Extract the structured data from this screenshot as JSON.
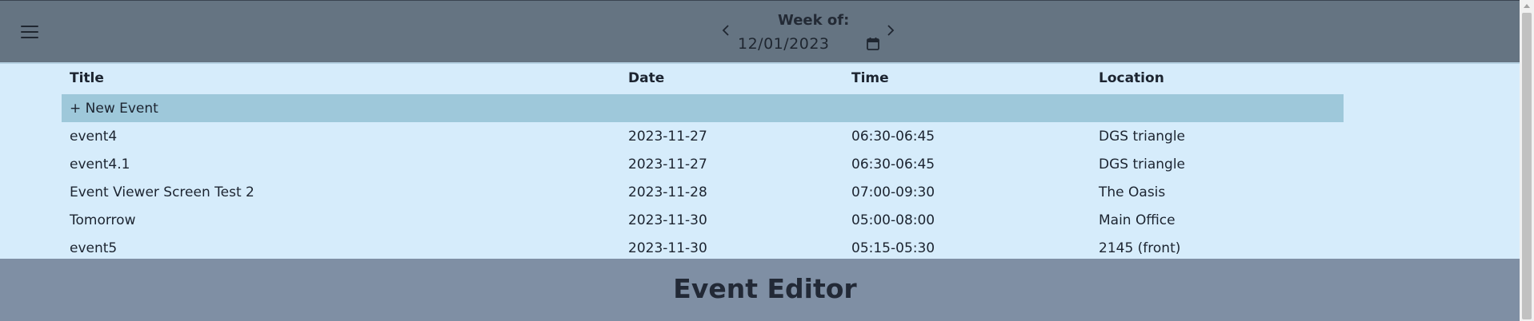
{
  "header": {
    "menu_icon": "hamburger-menu-icon",
    "week_label": "Week of:",
    "week_date": "12/01/2023",
    "prev_icon": "chevron-left-icon",
    "next_icon": "chevron-right-icon",
    "calendar_icon": "calendar-icon"
  },
  "table": {
    "columns": [
      "Title",
      "Date",
      "Time",
      "Location"
    ],
    "new_event_label": "+ New Event",
    "rows": [
      {
        "title": "event4",
        "date": "2023-11-27",
        "time": "06:30-06:45",
        "location": "DGS triangle"
      },
      {
        "title": "event4.1",
        "date": "2023-11-27",
        "time": "06:30-06:45",
        "location": "DGS triangle"
      },
      {
        "title": "Event Viewer Screen Test 2",
        "date": "2023-11-28",
        "time": "07:00-09:30",
        "location": "The Oasis"
      },
      {
        "title": "Tomorrow",
        "date": "2023-11-30",
        "time": "05:00-08:00",
        "location": "Main Office"
      },
      {
        "title": "event5",
        "date": "2023-11-30",
        "time": "05:15-05:30",
        "location": "2145 (front)"
      }
    ]
  },
  "editor": {
    "title": "Event Editor"
  },
  "colors": {
    "header_bg": "#657482",
    "table_bg": "#d6ecfb",
    "new_row_bg": "#9ec8da",
    "editor_bg": "#7f8fa4"
  }
}
